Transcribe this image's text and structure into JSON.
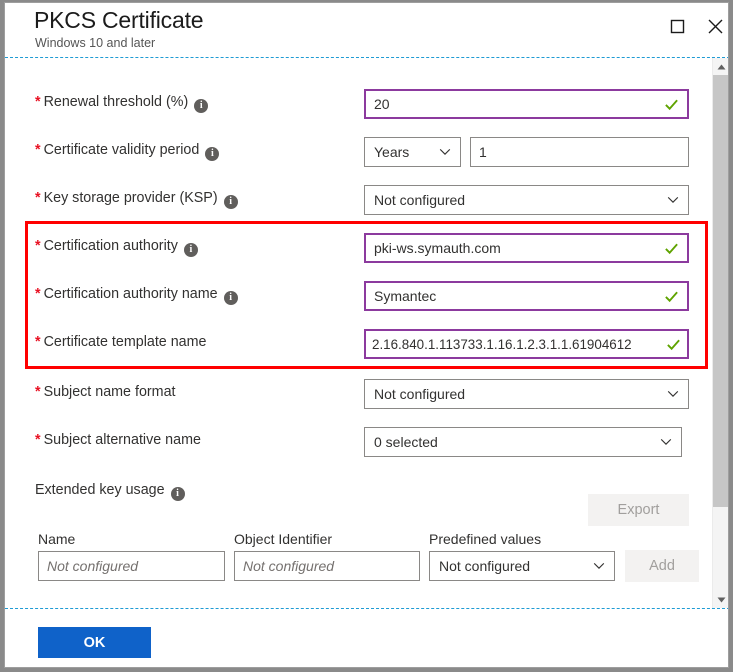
{
  "window": {
    "title": "PKCS Certificate",
    "subtitle": "Windows 10 and later",
    "maximize_label": "Maximize",
    "close_label": "Close"
  },
  "form": {
    "rows": [
      {
        "label": "Renewal threshold (%)",
        "required": "*",
        "has_info": true,
        "control": "text",
        "value": "20",
        "valid": true,
        "highlighted": true
      },
      {
        "label": "Certificate validity period",
        "required": "*",
        "has_info": true,
        "control": "unit-and-number",
        "unit_value": "Years",
        "number_value": "1"
      },
      {
        "label": "Key storage provider (KSP)",
        "required": "*",
        "has_info": true,
        "control": "select",
        "value": "Not configured"
      },
      {
        "label": "Certification authority",
        "required": "*",
        "has_info": true,
        "control": "text",
        "value": "pki-ws.symauth.com",
        "valid": true,
        "highlighted": true
      },
      {
        "label": "Certification authority name",
        "required": "*",
        "has_info": true,
        "control": "text",
        "value": "Symantec",
        "valid": true,
        "highlighted": true
      },
      {
        "label": "Certificate template name",
        "required": "*",
        "has_info": false,
        "control": "text",
        "value": "2.16.840.1.113733.1.16.1.2.3.1.1.61904612",
        "valid": true,
        "highlighted": true
      },
      {
        "label": "Subject name format",
        "required": "*",
        "has_info": false,
        "control": "select",
        "value": "Not configured"
      },
      {
        "label": "Subject alternative name",
        "required": "*",
        "has_info": false,
        "control": "select",
        "value": "0 selected"
      }
    ]
  },
  "extended_key_usage": {
    "section_label": "Extended key usage",
    "has_info": true,
    "export_label": "Export",
    "add_label": "Add",
    "columns": [
      "Name",
      "Object Identifier",
      "Predefined values"
    ],
    "new_row": {
      "name_placeholder": "Not configured",
      "oid_placeholder": "Not configured",
      "predefined_value": "Not configured"
    }
  },
  "footer": {
    "ok_label": "OK"
  },
  "colors": {
    "required_asterisk": "#e81123",
    "highlight_box": "#ff0000",
    "focus_border": "#8c3a9e",
    "valid_check": "#5fa300",
    "primary_button": "#0f62c9",
    "dashed_separator": "#1f9bd4"
  }
}
